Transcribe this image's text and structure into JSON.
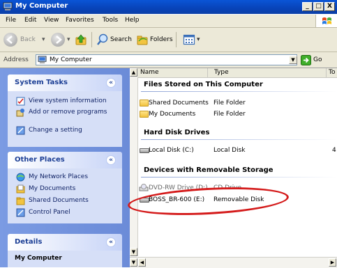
{
  "window": {
    "title": "My Computer",
    "min": "_",
    "max": "□",
    "close": "X"
  },
  "menu": [
    "File",
    "Edit",
    "View",
    "Favorites",
    "Tools",
    "Help"
  ],
  "toolbar": {
    "back": "Back",
    "search": "Search",
    "folders": "Folders"
  },
  "address": {
    "label": "Address",
    "value": "My Computer",
    "go": "Go"
  },
  "left": {
    "system_tasks": {
      "title": "System Tasks",
      "items": [
        "View system information",
        "Add or remove programs",
        "Change a setting"
      ]
    },
    "other_places": {
      "title": "Other Places",
      "items": [
        "My Network Places",
        "My Documents",
        "Shared Documents",
        "Control Panel"
      ]
    },
    "details": {
      "title": "Details",
      "name": "My Computer"
    }
  },
  "columns": {
    "name": "Name",
    "type": "Type",
    "total": "To"
  },
  "groups": {
    "files": "Files Stored on This Computer",
    "hdd": "Hard Disk Drives",
    "removable": "Devices with Removable Storage"
  },
  "files": [
    {
      "name": "Shared Documents",
      "type": "File Folder"
    },
    {
      "name": "My Documents",
      "type": "File Folder"
    }
  ],
  "drives": [
    {
      "name": "Local Disk (C:)",
      "type": "Local Disk",
      "total": "4"
    }
  ],
  "removable": [
    {
      "name": "DVD-RW Drive (D:)",
      "type": "CD Drive"
    },
    {
      "name": "BOSS_BR-600 (E:)",
      "type": "Removable Disk"
    }
  ]
}
